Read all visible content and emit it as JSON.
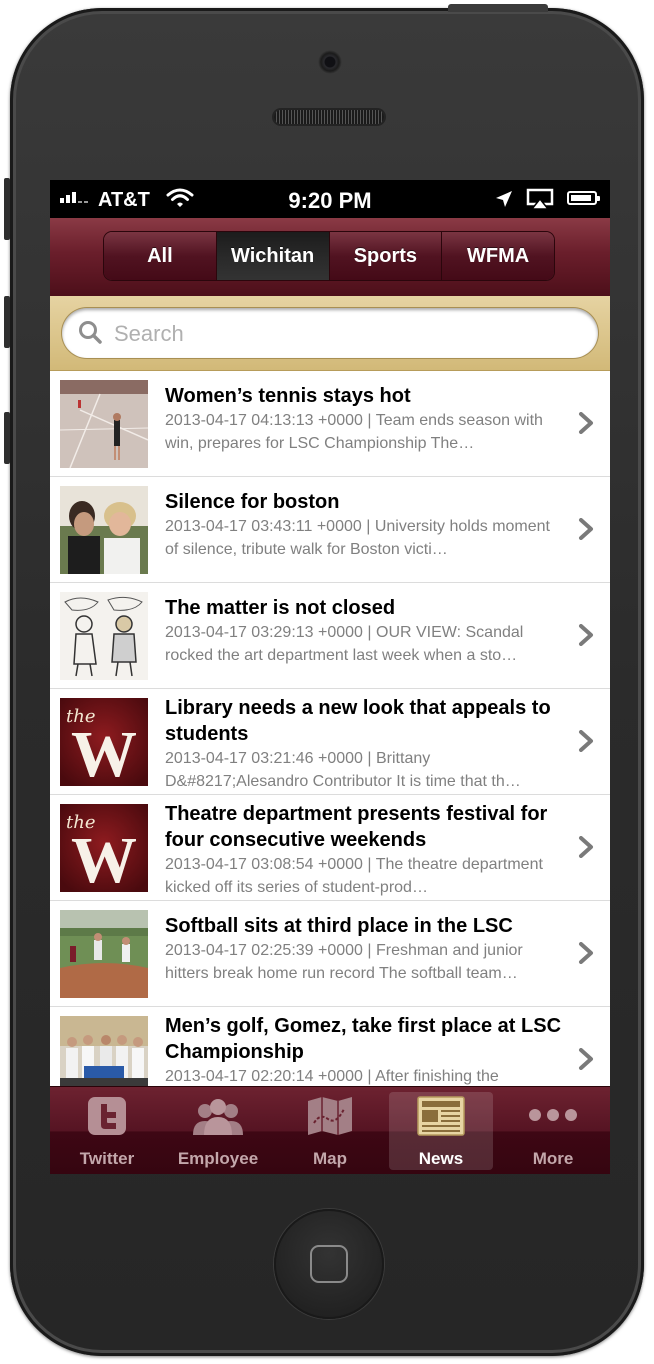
{
  "status_bar": {
    "carrier": "AT&T",
    "time": "9:20 PM",
    "signal_bars": 3,
    "battery_level": 0.9
  },
  "segments": {
    "items": [
      "All",
      "Wichitan",
      "Sports",
      "WFMA"
    ],
    "selected": "Wichitan"
  },
  "search": {
    "placeholder": "Search",
    "value": ""
  },
  "articles": [
    {
      "title": "Women’s tennis stays hot",
      "subtitle": "2013-04-17 04:13:13 +0000 | Team ends season with win, prepares for LSC Championship The…",
      "thumbnail": "tennis-photo"
    },
    {
      "title": "Silence for boston",
      "subtitle": "2013-04-17 03:43:11 +0000 | University holds moment of silence, tribute walk for Boston victi…",
      "thumbnail": "people-photo"
    },
    {
      "title": "The matter is not closed",
      "subtitle": "2013-04-17 03:29:13 +0000 | OUR VIEW: Scandal rocked the art department last week when a sto…",
      "thumbnail": "cartoon-sketch"
    },
    {
      "title": "Library needs a new look that appeals to students",
      "subtitle": "2013-04-17 03:21:46 +0000 | Brittany D&#8217;Alesandro Contributor It is time that th…",
      "thumbnail": "the-w-logo"
    },
    {
      "title": "Theatre department presents festival for four consecutive weekends",
      "subtitle": "2013-04-17 03:08:54 +0000 | The theatre department kicked off its series of student-prod…",
      "thumbnail": "the-w-logo"
    },
    {
      "title": "Softball sits at third place in the LSC",
      "subtitle": "2013-04-17 02:25:39 +0000 | Freshman and junior hitters break home run record The softball team…",
      "thumbnail": "softball-photo"
    },
    {
      "title": "Men’s golf, Gomez, take first place at LSC Championship",
      "subtitle": "2013-04-17 02:20:14 +0000 | After finishing the",
      "thumbnail": "golf-team-photo"
    }
  ],
  "logo_text": {
    "the": "the",
    "letter": "W"
  },
  "tabs": [
    {
      "label": "Twitter",
      "icon": "twitter-icon"
    },
    {
      "label": "Employee",
      "icon": "people-icon"
    },
    {
      "label": "Map",
      "icon": "map-icon"
    },
    {
      "label": "News",
      "icon": "newspaper-icon",
      "active": true
    },
    {
      "label": "More",
      "icon": "more-dots-icon"
    }
  ],
  "colors": {
    "brand_maroon": "#6a1e2b",
    "brand_gold": "#d2b978"
  }
}
